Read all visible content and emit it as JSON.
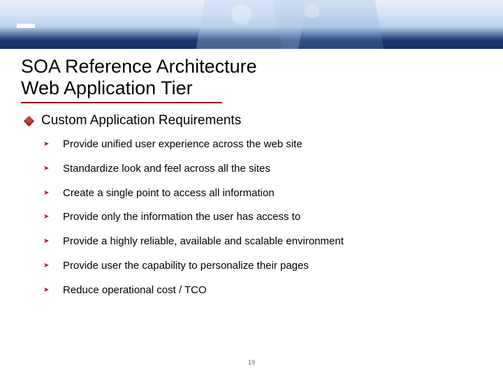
{
  "title_line1": "SOA Reference Architecture",
  "title_line2": "Web Application Tier",
  "subhead": "Custom Application Requirements",
  "items": [
    "Provide unified user experience across the web site",
    "Standardize look and feel across all the sites",
    "Create a single point to access all information",
    "Provide only the information the user has access to",
    "Provide a highly reliable, available and scalable environment",
    "Provide user the capability to personalize their pages",
    "Reduce operational cost / TCO"
  ],
  "page_number": "19"
}
